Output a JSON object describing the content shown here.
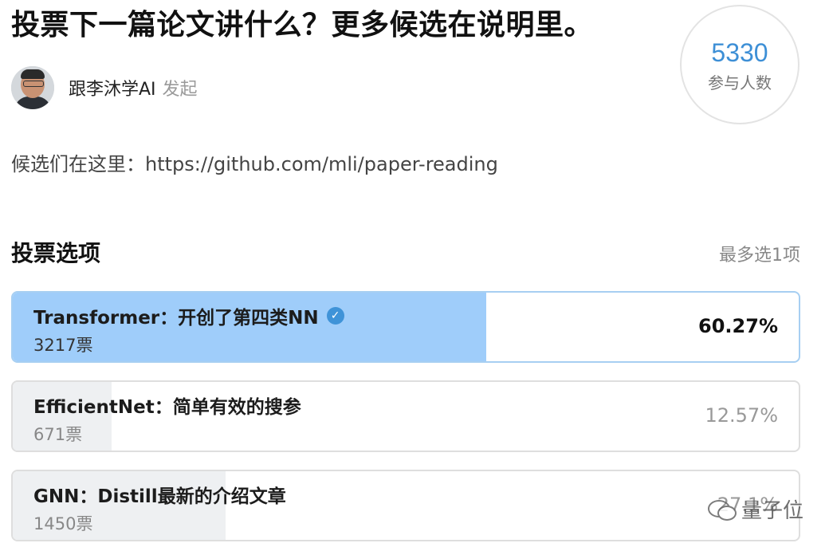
{
  "poll": {
    "title": "投票下一篇论文讲什么？更多候选在说明里。",
    "author": {
      "name": "跟李沐学AI",
      "suffix": "发起"
    },
    "participants": {
      "count": "5330",
      "label": "参与人数"
    },
    "description": "候选们在这里：https://github.com/mli/paper-reading"
  },
  "options_header": {
    "title": "投票选项",
    "limit": "最多选1项"
  },
  "options": [
    {
      "label": "Transformer：开创了第四类NN",
      "votes": "3217票",
      "percent": "60.27%",
      "fraction": 0.6027,
      "selected": true
    },
    {
      "label": "EfficientNet：简单有效的搜参",
      "votes": "671票",
      "percent": "12.57%",
      "fraction": 0.1257,
      "selected": false
    },
    {
      "label": "GNN：Distill最新的介绍文章",
      "votes": "1450票",
      "percent": "27.1%",
      "fraction": 0.271,
      "selected": false
    }
  ],
  "watermark": {
    "text": "量子位",
    "icon": "wechat-icon"
  },
  "colors": {
    "accent": "#3d8fd6",
    "selected_fill": "#9fcdfa",
    "bar_fill": "#eef0f2"
  }
}
